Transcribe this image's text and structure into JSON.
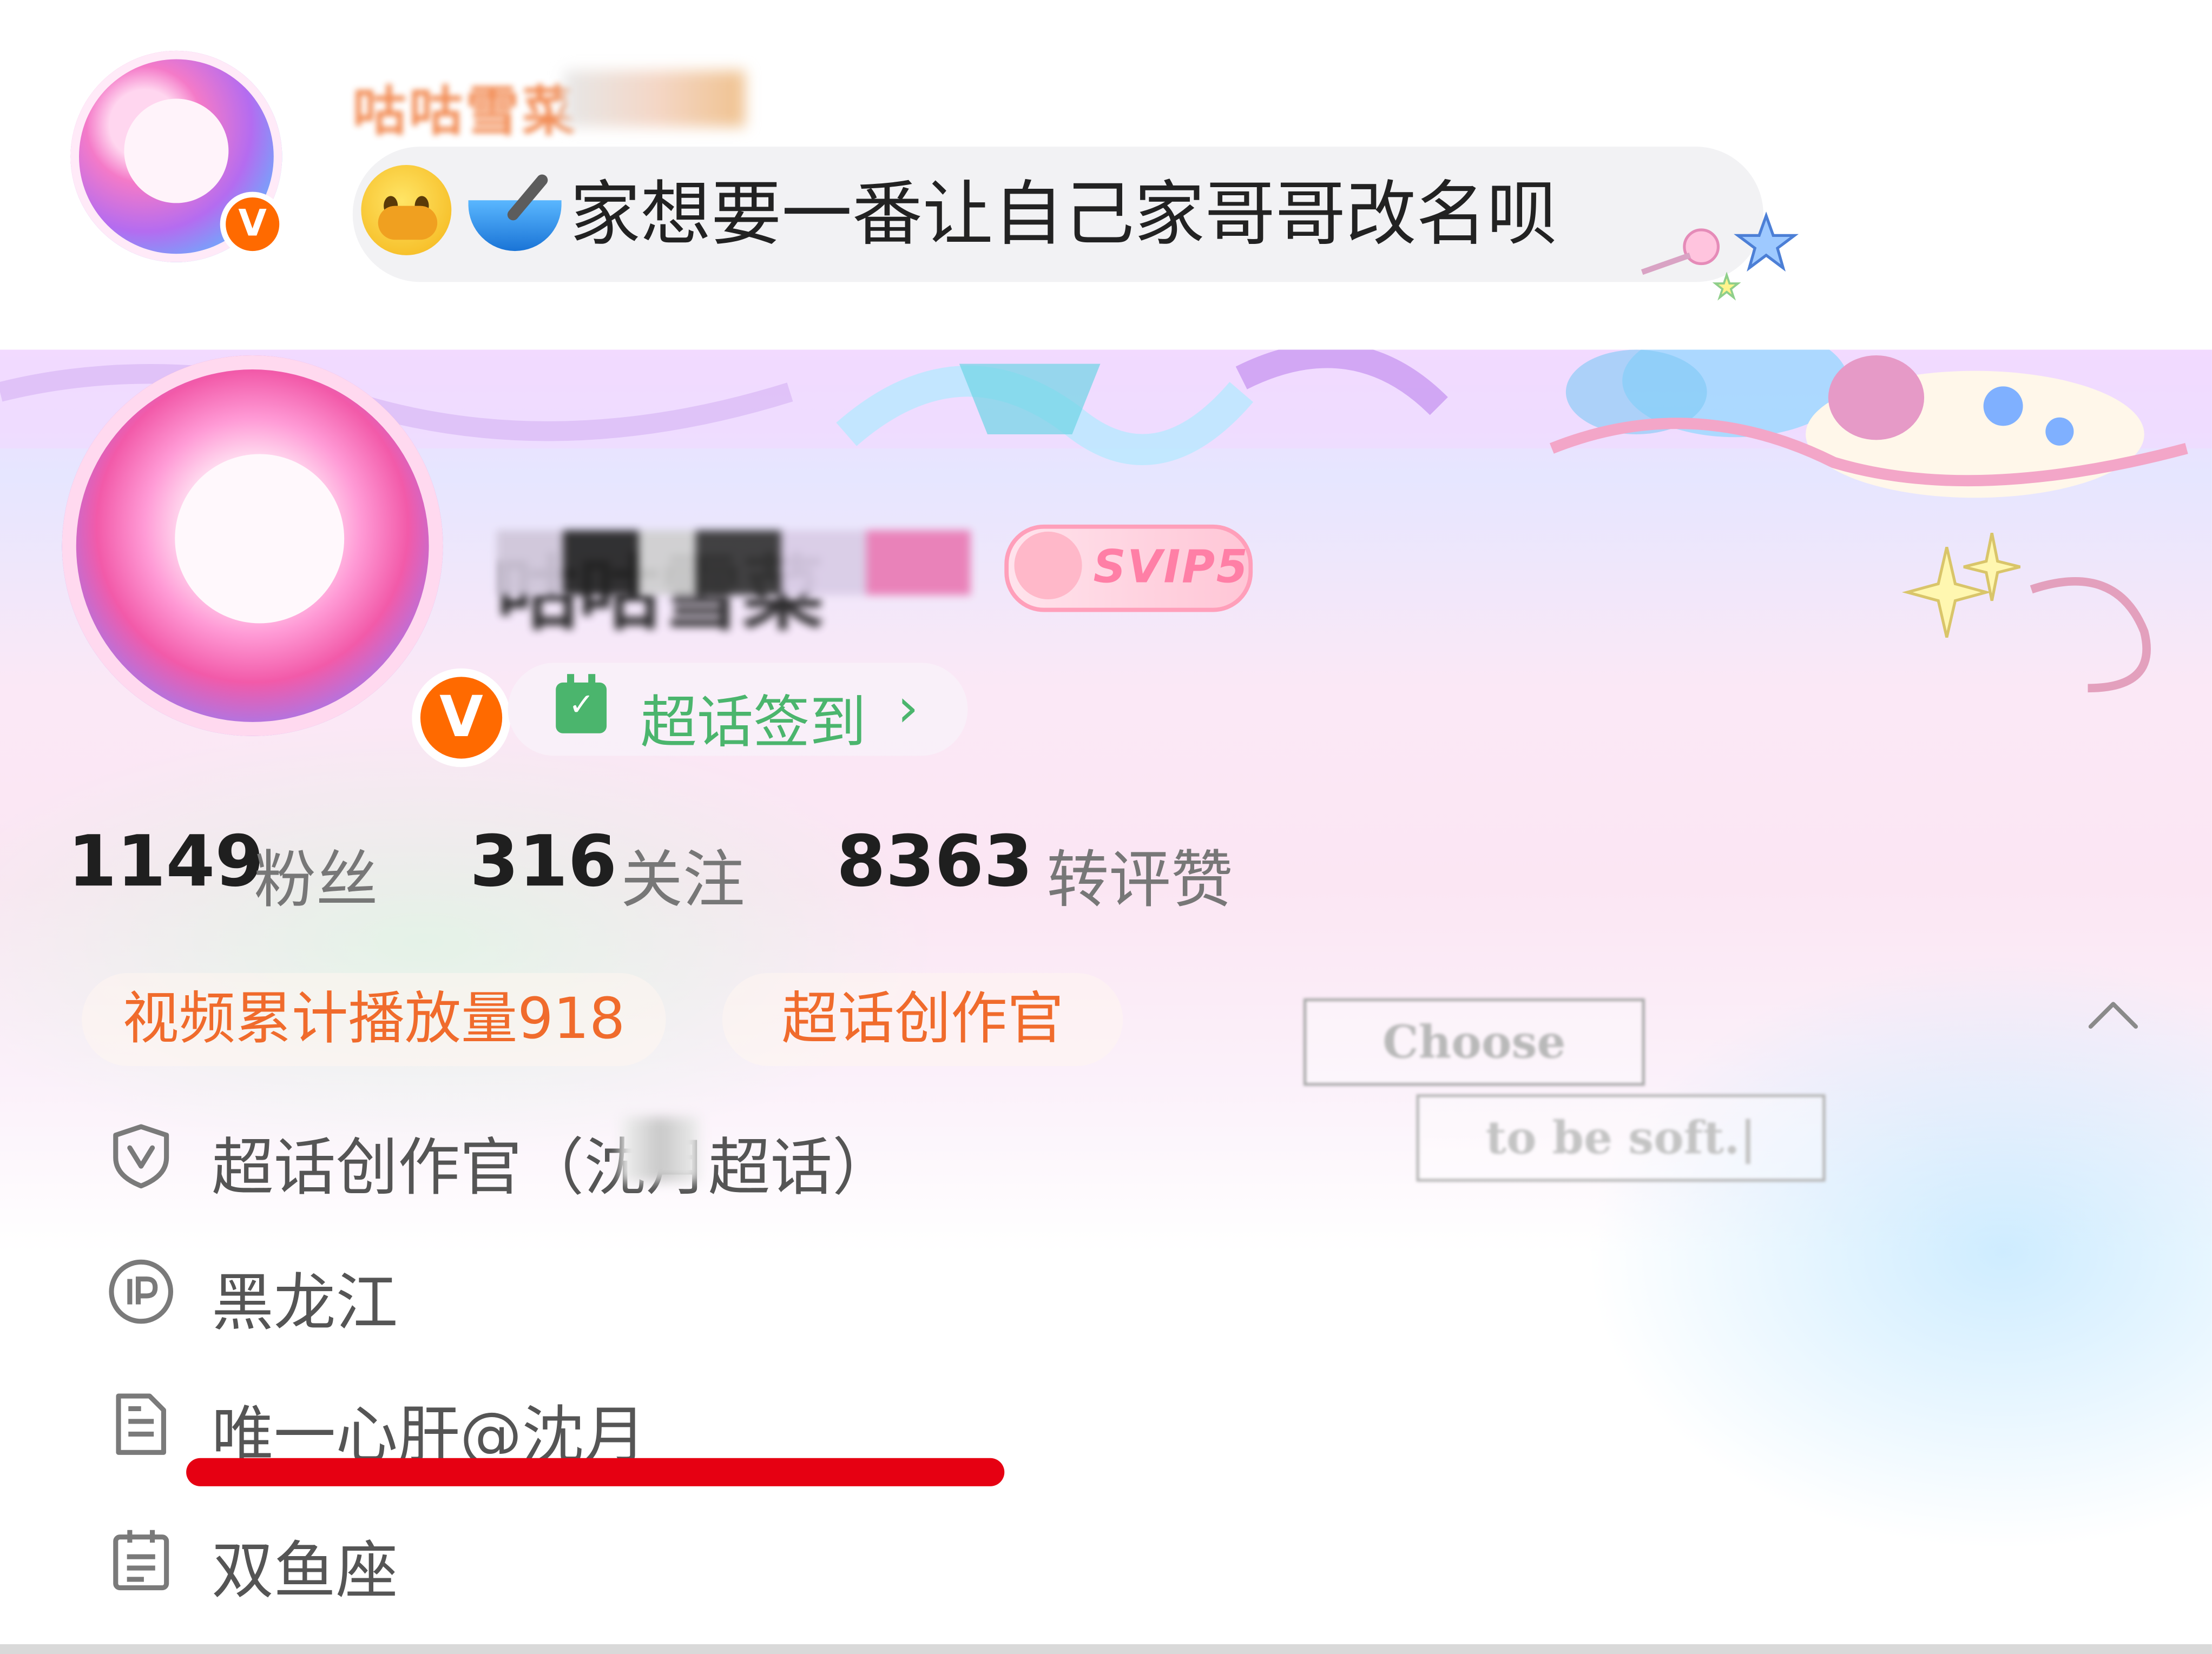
{
  "comment": {
    "user_name": "咕咕雪菜",
    "emojis": [
      "crying-face-emoji",
      "bowl-emoji"
    ],
    "text": "家想要一番让自己家哥哥改名呗"
  },
  "profile": {
    "name": "咕咕雪菜",
    "vip_badge": "SVIP5",
    "checkin_label": "超话签到",
    "checkin_arrow": "›",
    "stats": [
      {
        "value": "1149",
        "label": "粉丝"
      },
      {
        "value": "316",
        "label": "关注"
      },
      {
        "value": "8363",
        "label": "转评赞"
      }
    ],
    "tags": [
      "视频累计播放量918",
      "超话创作官"
    ],
    "signature_lines": [
      "Choose",
      "to be soft.|"
    ],
    "info": [
      {
        "icon": "shield-v-icon",
        "text": "超话创作官（沈月超话）"
      },
      {
        "icon": "ip-location-icon",
        "text": "黑龙江"
      },
      {
        "icon": "document-icon",
        "text": "唯一心肝@沈月"
      },
      {
        "icon": "calendar-list-icon",
        "text": "双鱼座"
      }
    ]
  },
  "colors": {
    "accent_orange": "#f06b2c",
    "verified_orange": "#ff6a00",
    "checkin_green": "#4bb56d",
    "svip_pink": "#ff7fa6",
    "highlight_red": "#e60012"
  }
}
